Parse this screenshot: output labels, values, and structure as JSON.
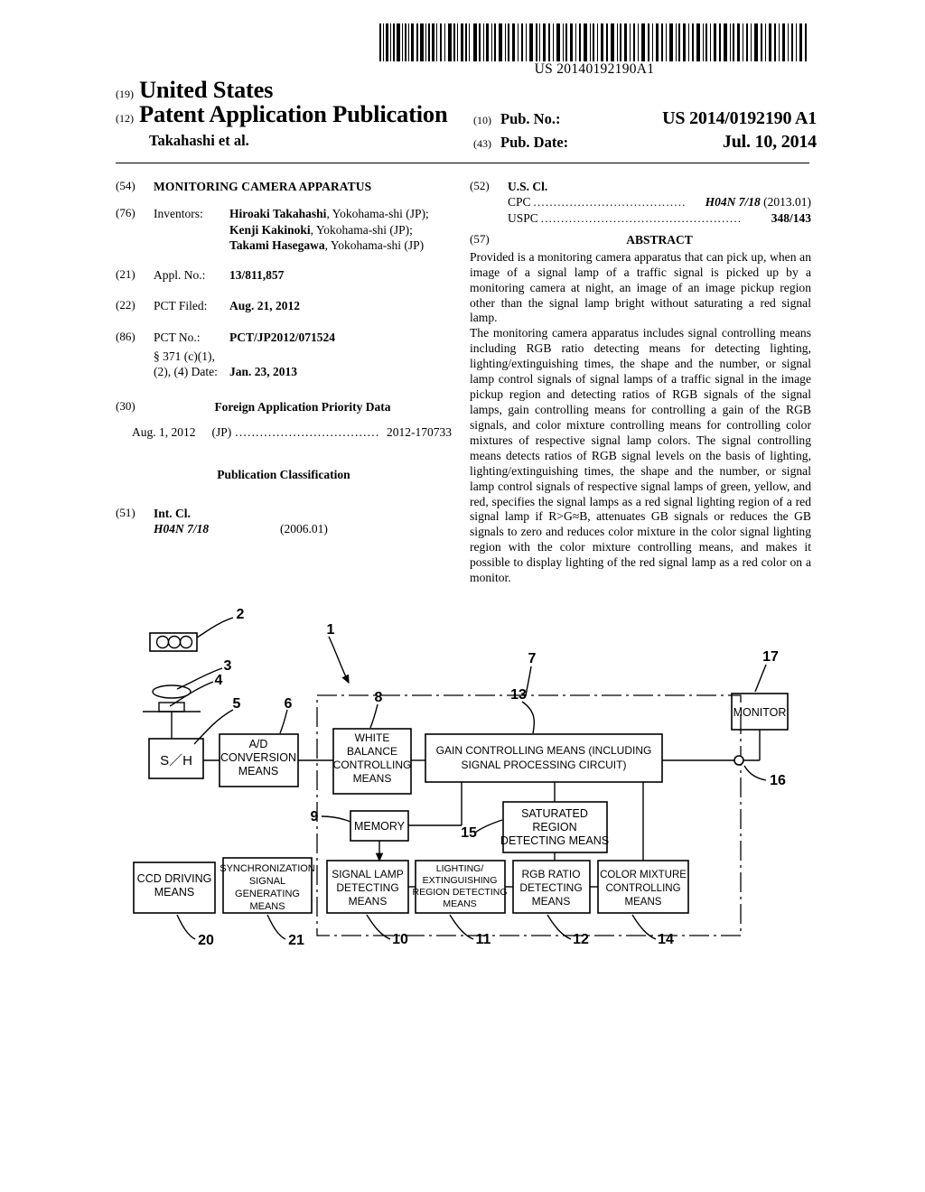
{
  "barcode": {
    "number": "US 20140192190A1",
    "alt": "barcode"
  },
  "header": {
    "code_19": "(19)",
    "country": "United States",
    "code_12": "(12)",
    "doc_type": "Patent Application Publication",
    "applicant": "Takahashi et al.",
    "pub_no_code": "(10)",
    "pub_no_label": "Pub. No.:",
    "pub_no_value": "US 2014/0192190 A1",
    "pub_date_code": "(43)",
    "pub_date_label": "Pub. Date:",
    "pub_date_value": "Jul. 10, 2014"
  },
  "left_column": {
    "title_code": "(54)",
    "title": "MONITORING CAMERA APPARATUS",
    "inventors_code": "(76)",
    "inventors_label": "Inventors:",
    "inventors": [
      {
        "name": "Hiroaki Takahashi",
        "residence": ", Yokohama-shi (JP);"
      },
      {
        "name": "Kenji Kakinoki",
        "residence": ", Yokohama-shi (JP);"
      },
      {
        "name": "Takami Hasegawa",
        "residence": ", Yokohama-shi (JP)"
      }
    ],
    "appl_no_code": "(21)",
    "appl_no_label": "Appl. No.:",
    "appl_no_value": "13/811,857",
    "pct_filed_code": "(22)",
    "pct_filed_label": "PCT Filed:",
    "pct_filed_value": "Aug. 21, 2012",
    "pct_no_code": "(86)",
    "pct_no_label": "PCT No.:",
    "pct_no_value": "PCT/JP2012/071524",
    "s371_line1": "§ 371 (c)(1),",
    "s371_line2": "(2), (4) Date:",
    "s371_value": "Jan. 23, 2013",
    "priority_code": "(30)",
    "priority_heading": "Foreign Application Priority Data",
    "priority_date": "Aug. 1, 2012",
    "priority_country": "(JP)",
    "priority_dots": "...................................",
    "priority_number": "2012-170733",
    "pub_class_heading": "Publication Classification",
    "intcl_code": "(51)",
    "intcl_label": "Int. Cl.",
    "intcl_value": "H04N 7/18",
    "intcl_version": "(2006.01)"
  },
  "right_column": {
    "uscl_code": "(52)",
    "uscl_label": "U.S. Cl.",
    "cpc_label": "CPC",
    "cpc_dots": "......................................",
    "cpc_value": "H04N 7/18",
    "cpc_version": "(2013.01)",
    "uspc_label": "USPC",
    "uspc_dots": "..................................................",
    "uspc_value": "348/143",
    "abstract_code": "(57)",
    "abstract_heading": "ABSTRACT",
    "abstract_paragraphs": [
      "Provided is a monitoring camera apparatus that can pick up, when an image of a signal lamp of a traffic signal is picked up by a monitoring camera at night, an image of an image pickup region other than the signal lamp bright without saturating a red signal lamp.",
      "The monitoring camera apparatus includes signal controlling means including RGB ratio detecting means for detecting lighting, lighting/extinguishing times, the shape and the number, or signal lamp control signals of signal lamps of a traffic signal in the image pickup region and detecting ratios of RGB signals of the signal lamps, gain controlling means for controlling a gain of the RGB signals, and color mixture controlling means for controlling color mixtures of respective signal lamp colors. The signal controlling means detects ratios of RGB signal levels on the basis of lighting, lighting/extinguishing times, the shape and the number, or signal lamp control signals of respective signal lamps of green, yellow, and red, specifies the signal lamps as a red signal lighting region of a red signal lamp if R>G≈B, attenuates GB signals or reduces the GB signals to zero and reduces color mixture in the color signal lighting region with the color mixture controlling means, and makes it possible to display lighting of the red signal lamp as a red color on a monitor."
    ]
  },
  "figure": {
    "blocks": [
      {
        "id": "sh",
        "label": "S／H"
      },
      {
        "id": "ad",
        "label": "A/D CONVERSION MEANS",
        "lines": [
          "A/D",
          "CONVERSION",
          "MEANS"
        ]
      },
      {
        "id": "wb",
        "label": "WHITE BALANCE CONTROLLING MEANS",
        "lines": [
          "WHITE",
          "BALANCE",
          "CONTROLLING",
          "MEANS"
        ]
      },
      {
        "id": "gain",
        "label": "GAIN CONTROLLING MEANS (INCLUDING SIGNAL PROCESSING CIRCUIT)",
        "lines": [
          "GAIN CONTROLLING MEANS (INCLUDING",
          "SIGNAL PROCESSING CIRCUIT)"
        ]
      },
      {
        "id": "monitor",
        "label": "MONITOR",
        "lines": [
          "MONITOR"
        ]
      },
      {
        "id": "memory",
        "label": "MEMORY",
        "lines": [
          "MEMORY"
        ]
      },
      {
        "id": "saturated",
        "label": "SATURATED REGION DETECTING MEANS",
        "lines": [
          "SATURATED",
          "REGION",
          "DETECTING MEANS"
        ]
      },
      {
        "id": "ccd",
        "label": "CCD DRIVING MEANS",
        "lines": [
          "CCD DRIVING",
          "MEANS"
        ]
      },
      {
        "id": "sync",
        "label": "SYNCHRONIZATION SIGNAL GENERATING MEANS",
        "lines": [
          "SYNCHRONIZATION",
          "SIGNAL",
          "GENERATING",
          "MEANS"
        ]
      },
      {
        "id": "siglamp",
        "label": "SIGNAL LAMP DETECTING MEANS",
        "lines": [
          "SIGNAL LAMP",
          "DETECTING",
          "MEANS"
        ]
      },
      {
        "id": "lighting",
        "label": "LIGHTING/ EXTINGUISHING REGION DETECTING MEANS",
        "lines": [
          "LIGHTING/",
          "EXTINGUISHING",
          "REGION DETECTING",
          "MEANS"
        ]
      },
      {
        "id": "rgbratio",
        "label": "RGB RATIO DETECTING MEANS",
        "lines": [
          "RGB RATIO",
          "DETECTING",
          "MEANS"
        ]
      },
      {
        "id": "colormix",
        "label": "COLOR MIXTURE CONTROLLING MEANS",
        "lines": [
          "COLOR MIXTURE",
          "CONTROLLING",
          "MEANS"
        ]
      }
    ],
    "reference_numerals": [
      {
        "id": "n1",
        "text": "1"
      },
      {
        "id": "n2",
        "text": "2"
      },
      {
        "id": "n3",
        "text": "3"
      },
      {
        "id": "n4",
        "text": "4"
      },
      {
        "id": "n5",
        "text": "5"
      },
      {
        "id": "n6",
        "text": "6"
      },
      {
        "id": "n7",
        "text": "7"
      },
      {
        "id": "n8",
        "text": "8"
      },
      {
        "id": "n9",
        "text": "9"
      },
      {
        "id": "n10",
        "text": "10"
      },
      {
        "id": "n11",
        "text": "11"
      },
      {
        "id": "n12",
        "text": "12"
      },
      {
        "id": "n13",
        "text": "13"
      },
      {
        "id": "n14",
        "text": "14"
      },
      {
        "id": "n15",
        "text": "15"
      },
      {
        "id": "n16",
        "text": "16"
      },
      {
        "id": "n17",
        "text": "17"
      },
      {
        "id": "n20",
        "text": "20"
      },
      {
        "id": "n21",
        "text": "21"
      }
    ]
  }
}
